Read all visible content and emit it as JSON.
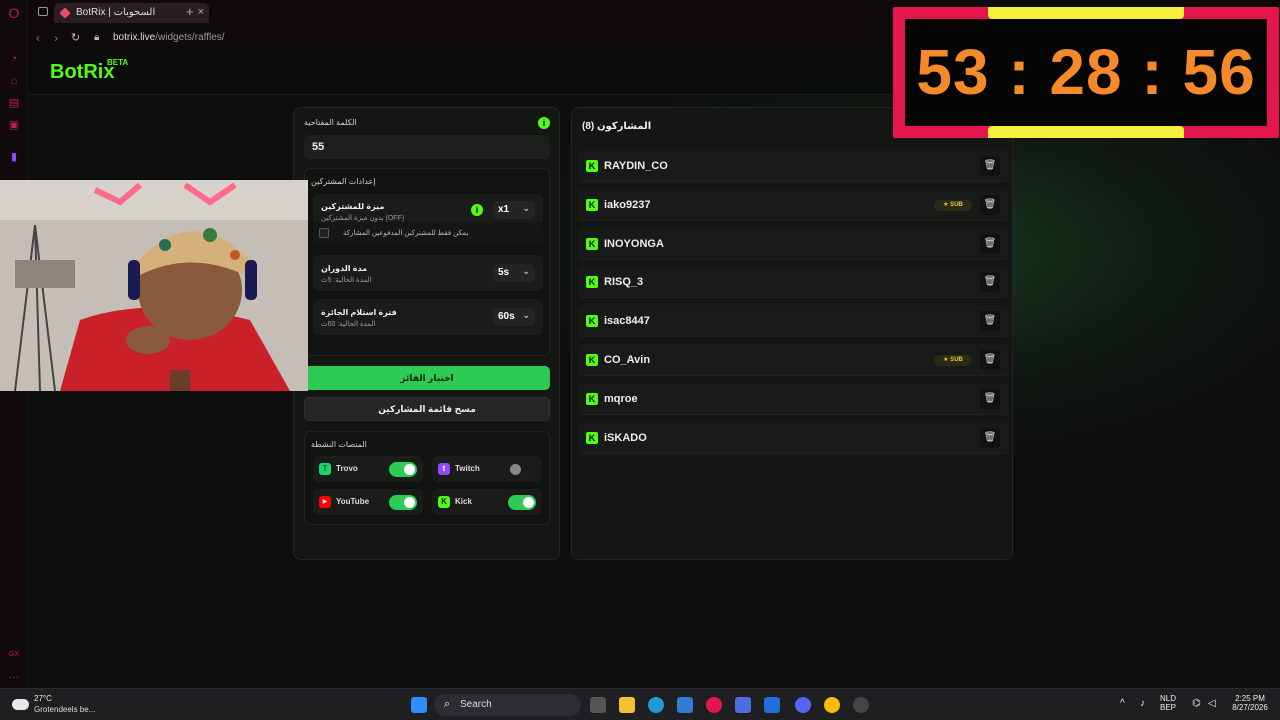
{
  "browser": {
    "tab_title": "BotRix | السحوبات",
    "url_domain": "botrix.live",
    "url_path": "/widgets/raffles/"
  },
  "header": {
    "logo": "BotRix",
    "beta": "BETA"
  },
  "settings": {
    "keyword_label": "الكلمة المفتاحية",
    "keyword_value": "55",
    "section_title": "إعدادات المشتركين",
    "rows": [
      {
        "title": "ميزة للمشتركين",
        "sub": "بدون ميزة المشتركين (OFF)",
        "value": "x1"
      },
      {
        "title": "مدة الدوران",
        "sub": "المدة الحالية: 5ث",
        "value": "5s"
      },
      {
        "title": "فترة استلام الجائزة",
        "sub": "المدة الحالية: 60ث",
        "value": "60s"
      }
    ],
    "checkbox_label": "يمكن فقط للمشتركين المدفوعين المشاركة",
    "pick_winner": "اختيار الفائز",
    "clear_list": "مسح قائمة المشاركين",
    "platforms_title": "المنصات النشطة",
    "platforms": [
      {
        "name": "Trovo",
        "on": true,
        "color": "#19d66b"
      },
      {
        "name": "Twitch",
        "on": false,
        "color": "#9146ff"
      },
      {
        "name": "YouTube",
        "on": true,
        "color": "#ff0000"
      },
      {
        "name": "Kick",
        "on": true,
        "color": "#53fc18"
      }
    ]
  },
  "participants": {
    "title": "المشاركون (8)",
    "sub_badge": "★ SUB",
    "list": [
      {
        "name": "RAYDIN_CO",
        "sub": false
      },
      {
        "name": "iako9237",
        "sub": true
      },
      {
        "name": "INOYONGA",
        "sub": false
      },
      {
        "name": "RISQ_3",
        "sub": false
      },
      {
        "name": "isac8447",
        "sub": false
      },
      {
        "name": "CO_Avin",
        "sub": true
      },
      {
        "name": "mqroe",
        "sub": false
      },
      {
        "name": "iSKADO",
        "sub": false
      }
    ]
  },
  "timer": {
    "display": "53 : 28 : 56"
  },
  "taskbar": {
    "temp": "27°C",
    "condition": "Grotendeels be...",
    "search": "Search",
    "lang_top": "NLD",
    "lang_bot": "BEP",
    "time": "2:25 PM",
    "date": "8/27/2026"
  },
  "colors": {
    "accent": "#53fc18",
    "timer_frame": "#e5164e",
    "timer_digits": "#f58a2a"
  }
}
